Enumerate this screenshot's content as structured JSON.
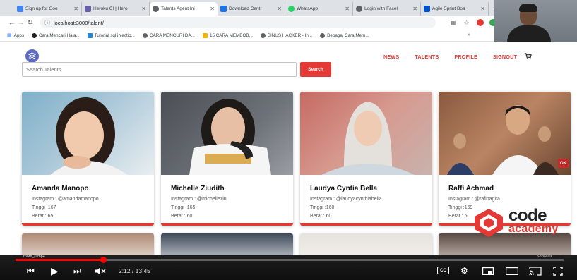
{
  "browser": {
    "tabs": [
      {
        "title": "Sign up for Goo",
        "favicon_color": "#4285f4"
      },
      {
        "title": "Heroku CI | Hero",
        "favicon_color": "#6762a6"
      },
      {
        "title": "Talents Agent Ini",
        "favicon_color": "#5f6368",
        "active": true
      },
      {
        "title": "Download Centr",
        "favicon_color": "#1a73e8"
      },
      {
        "title": "WhatsApp",
        "favicon_color": "#25d366"
      },
      {
        "title": "Login with Facel",
        "favicon_color": "#5f6368"
      },
      {
        "title": "Agile Sprint Boa",
        "favicon_color": "#0052cc"
      }
    ],
    "new_tab": "+",
    "url": "localhost:3000/talent/",
    "bookmarks": [
      {
        "label": "Apps",
        "color": "#4285f4"
      },
      {
        "label": "Cara Mencari Hala...",
        "color": "#222222"
      },
      {
        "label": "Tutorial sql injectio...",
        "color": "#1e88e5"
      },
      {
        "label": "CARA MENCURI DA...",
        "color": "#5f6368"
      },
      {
        "label": "15 CARA MEMBOB...",
        "color": "#f4b400"
      },
      {
        "label": "BINUS HACKER - In...",
        "color": "#5f6368"
      },
      {
        "label": "Bebagai Cara Mem...",
        "color": "#5f6368"
      }
    ],
    "bookmarks_more": "»"
  },
  "site": {
    "nav": [
      "NEWS",
      "TALENTS",
      "PROFILE",
      "SIGNOUT"
    ],
    "search_placeholder": "Search Talents",
    "search_button": "Search",
    "accent": "#e53935",
    "talents": [
      {
        "name": "Amanda Manopo",
        "instagram": "Instagram : @amandamanopo",
        "tinggi": "Tinggi :167",
        "berat": "Berat : 65"
      },
      {
        "name": "Michelle Ziudith",
        "instagram": "Instagram : @michelleziu",
        "tinggi": "Tinggi :165",
        "berat": "Berat : 60"
      },
      {
        "name": "Laudya Cyntia Bella",
        "instagram": "Instagram : @laudyacynthiabella",
        "tinggi": "Tinggi :160",
        "berat": "Berat : 60"
      },
      {
        "name": "Raffi Achmad",
        "instagram": "Instagram : @rafinagita",
        "tinggi": "Tinggi :169",
        "berat": "Berat : 6"
      }
    ],
    "photo_badge": "OK"
  },
  "watermark": {
    "line1": "code",
    "line2": "academy"
  },
  "player": {
    "time": "2:12 / 13:45",
    "progress": 0.16,
    "chapter": "zoom_0.mp4",
    "show_all": "Show all",
    "cc": "CC"
  }
}
